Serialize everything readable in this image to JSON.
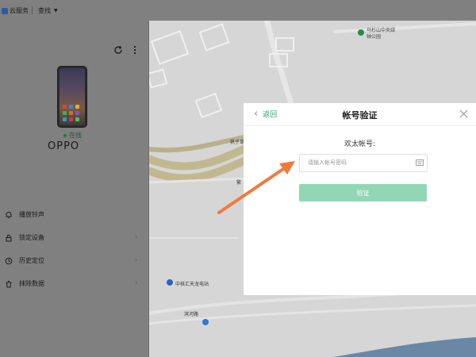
{
  "topbar": {
    "service_label": "云服务",
    "find_label": "查找"
  },
  "map": {
    "labels": [
      "马杉山中央绿轴公园",
      "帆子草",
      "中核汇天龙电站",
      "滨河路",
      "繁"
    ]
  },
  "device_panel": {
    "status_label": "在线",
    "device_name": "OPPO",
    "menu": [
      {
        "label": "播放铃声",
        "icon": "bell-icon",
        "has_chevron": false
      },
      {
        "label": "锁定设备",
        "icon": "lock-icon",
        "has_chevron": true
      },
      {
        "label": "历史定位",
        "icon": "clock-icon",
        "has_chevron": true
      },
      {
        "label": "抹除数据",
        "icon": "trash-icon",
        "has_chevron": true
      }
    ]
  },
  "dialog": {
    "back_label": "返回",
    "title": "帐号验证",
    "account_label": "欢太帐号:",
    "password_placeholder": "请输入帐号密码",
    "verify_label": "验证"
  },
  "colors": {
    "accent": "#2ea06a",
    "verify_button": "#92d7b5",
    "arrow": "#f07a3c",
    "overlay_gray": "#808080"
  }
}
